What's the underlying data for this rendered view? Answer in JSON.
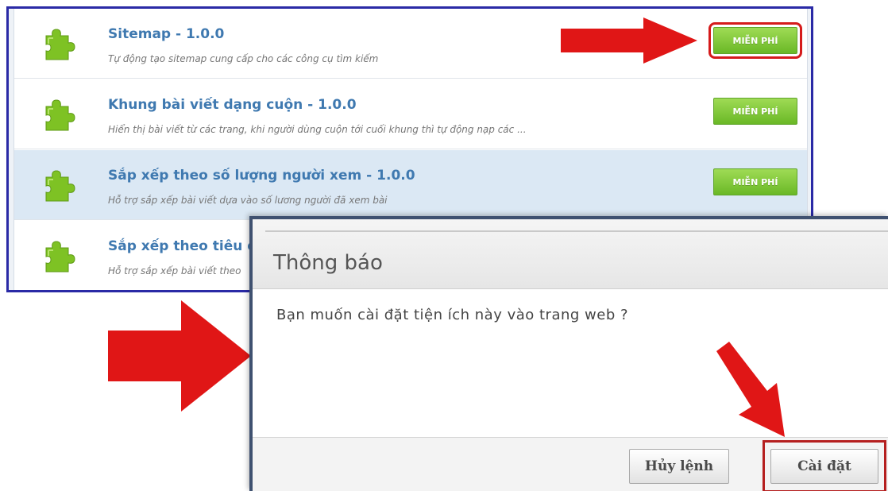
{
  "plugins": [
    {
      "title": "Sitemap - 1.0.0",
      "description": "Tự động tạo sitemap cung cấp cho các công cụ tìm kiếm",
      "button": "MIỄN PHÍ"
    },
    {
      "title": "Khung bài viết dạng cuộn - 1.0.0",
      "description": "Hiển thị bài viết từ các trang, khi người dùng cuộn tới cuối khung thì tự động nạp các ...",
      "button": "MIỄN PHÍ"
    },
    {
      "title": "Sắp xếp theo số lượng người xem - 1.0.0",
      "description": "Hỗ trợ sắp xếp bài viết dựa vào số lương người đã xem bài",
      "button": "MIỄN PHÍ"
    },
    {
      "title": "Sắp xếp theo tiêu đ",
      "description": "Hỗ trợ sắp xếp bài viết theo"
    }
  ],
  "dialog": {
    "title": "Thông báo",
    "message": "Bạn muốn cài đặt tiện ích này vào trang web ?",
    "cancel_label": "Hủy lệnh",
    "install_label": "Cài đặt"
  },
  "icons": {
    "plugin": "puzzle-piece-icon",
    "annotation": "red-arrow-icon"
  },
  "colors": {
    "plugin_icon": "#7ec224",
    "title_link": "#3f79b0",
    "free_button": "#7cc233",
    "highlight_row": "#dbe8f4",
    "annotation_red": "#e01616",
    "panel_border": "#2a2aa6"
  }
}
